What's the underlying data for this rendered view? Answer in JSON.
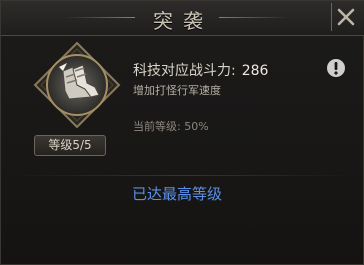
{
  "window": {
    "title": "突袭"
  },
  "tech": {
    "icon": "armored-boots-icon",
    "level_badge": "等级5/5",
    "stat_label": "科技对应战斗力:",
    "stat_value": "286",
    "description": "增加打怪行军速度",
    "current_level": "当前等级: 50%",
    "max_level_text": "已达最高等级"
  },
  "colors": {
    "max_level_text": "#5b8fe6",
    "title_text": "#c9c2b4"
  }
}
